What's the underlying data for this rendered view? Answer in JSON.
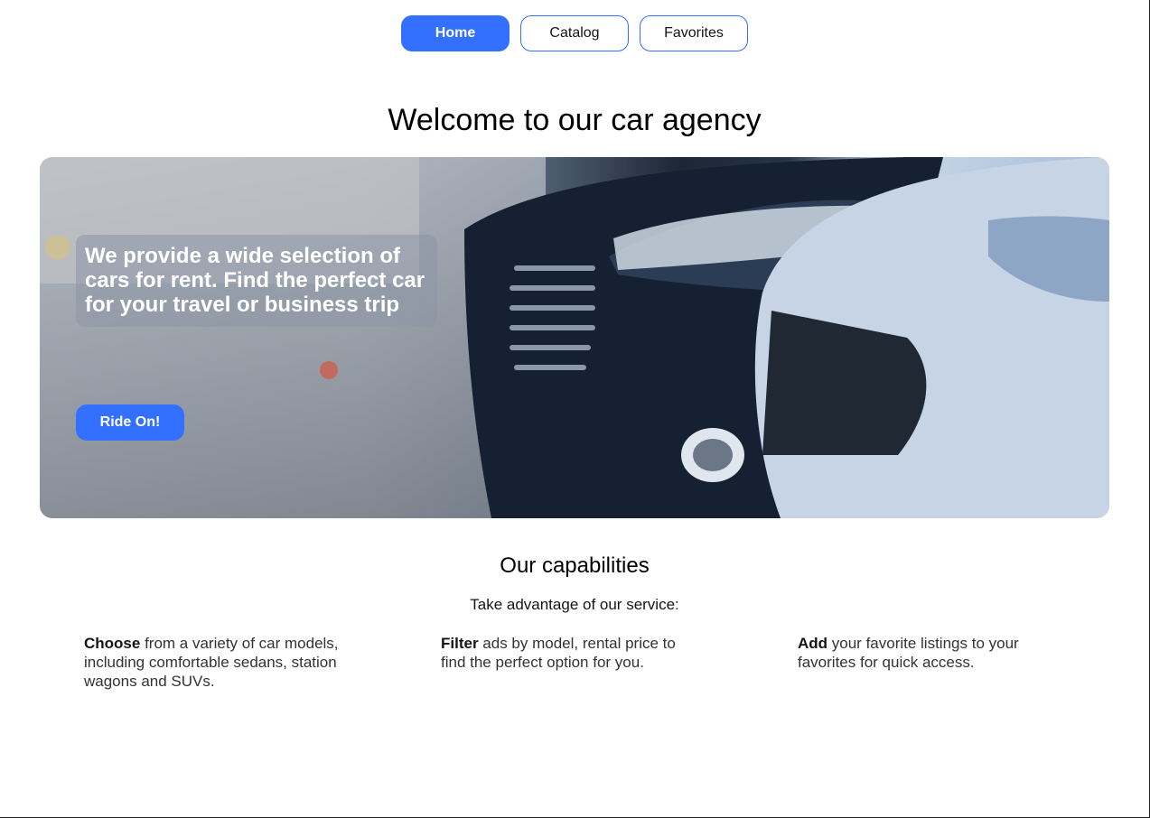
{
  "nav": {
    "items": [
      {
        "label": "Home",
        "active": true
      },
      {
        "label": "Catalog",
        "active": false
      },
      {
        "label": "Favorites",
        "active": false
      }
    ]
  },
  "page": {
    "title": "Welcome to our car agency"
  },
  "hero": {
    "caption": "We provide a wide selection of cars for rent. Find the perfect car for your travel or business trip",
    "cta_label": "Ride On!"
  },
  "capabilities": {
    "title": "Our capabilities",
    "subtitle": "Take advantage of our service:",
    "features": [
      {
        "lead": "Choose",
        "text": " from a variety of car models, including comfortable sedans, station wagons and SUVs."
      },
      {
        "lead": "Filter",
        "text": " ads by model, rental price to find the perfect option for you."
      },
      {
        "lead": "Add",
        "text": " your favorite listings to your favorites for quick access."
      }
    ]
  },
  "colors": {
    "accent": "#3470ff",
    "text": "#121417"
  }
}
